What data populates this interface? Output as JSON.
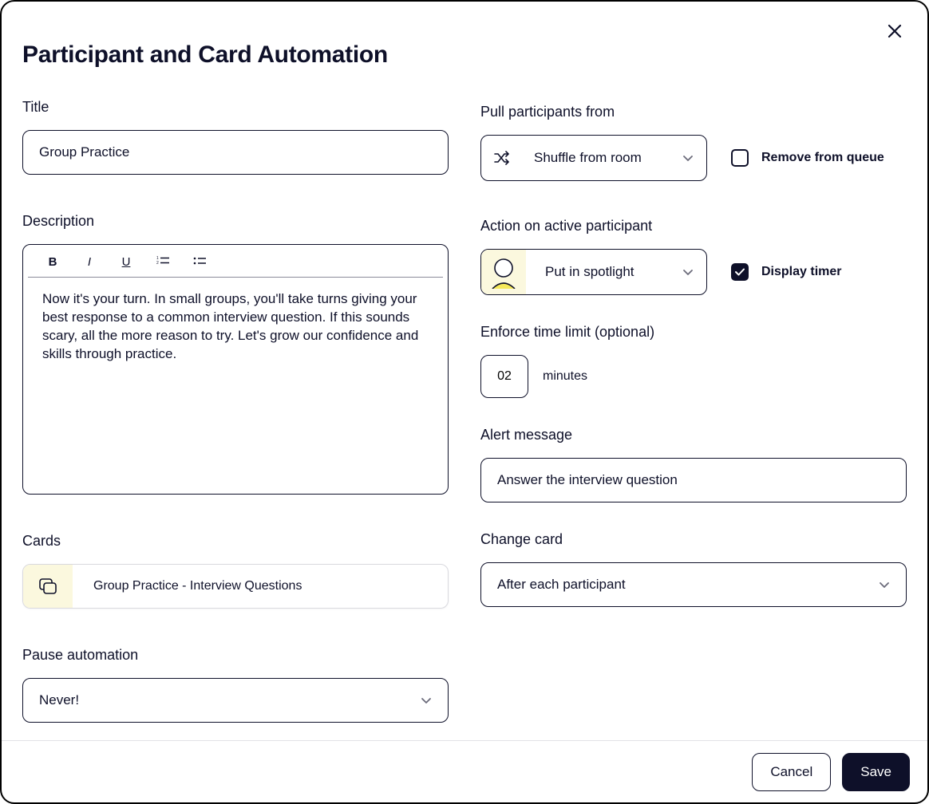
{
  "header": {
    "title": "Participant and Card Automation"
  },
  "left": {
    "title_label": "Title",
    "title_value": "Group Practice",
    "description_label": "Description",
    "description_value": "Now it's your turn. In small groups, you'll take turns giving your best response to a common interview question. If this sounds scary, all the more reason to try. Let's grow our confidence and skills through practice.",
    "cards_label": "Cards",
    "cards_value": "Group Practice - Interview Questions",
    "pause_label": "Pause automation",
    "pause_value": "Never!"
  },
  "right": {
    "pull_label": "Pull participants from",
    "pull_value": "Shuffle from room",
    "remove_queue_label": "Remove from queue",
    "remove_queue_checked": false,
    "action_label": "Action on active participant",
    "action_value": "Put in spotlight",
    "display_timer_label": "Display timer",
    "display_timer_checked": true,
    "time_limit_label": "Enforce time limit (optional)",
    "time_limit_value": "02",
    "minutes_label": "minutes",
    "alert_label": "Alert message",
    "alert_value": "Answer the interview question",
    "change_card_label": "Change card",
    "change_card_value": "After each participant"
  },
  "footer": {
    "cancel": "Cancel",
    "save": "Save"
  }
}
